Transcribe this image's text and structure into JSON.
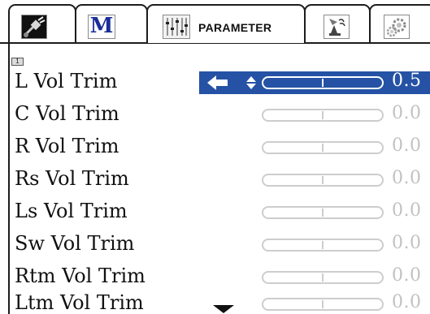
{
  "tabs": [
    {
      "name": "input",
      "icon": "plug-cable-icon"
    },
    {
      "name": "menu",
      "icon": "m-logo-icon",
      "glyph": "M"
    },
    {
      "name": "parameter",
      "icon": "equalizer-sliders-icon",
      "label": "PARAMETER"
    },
    {
      "name": "speaker",
      "icon": "speaker-satellite-icon"
    },
    {
      "name": "system",
      "icon": "gears-icon"
    }
  ],
  "page_badge": "1",
  "rows": [
    {
      "label": "L Vol Trim",
      "value": "0.5",
      "level": 0.5,
      "selected": true
    },
    {
      "label": "C Vol Trim",
      "value": "0.0",
      "level": 0.5,
      "selected": false
    },
    {
      "label": "R Vol Trim",
      "value": "0.0",
      "level": 0.5,
      "selected": false
    },
    {
      "label": "Rs Vol Trim",
      "value": "0.0",
      "level": 0.5,
      "selected": false
    },
    {
      "label": "Ls Vol Trim",
      "value": "0.0",
      "level": 0.5,
      "selected": false
    },
    {
      "label": "Sw Vol Trim",
      "value": "0.0",
      "level": 0.5,
      "selected": false
    },
    {
      "label": "Rtm Vol Trim",
      "value": "0.0",
      "level": 0.5,
      "selected": false
    },
    {
      "label": "Ltm Vol Trim",
      "value": "0.0",
      "level": 0.5,
      "selected": false
    }
  ],
  "colors": {
    "selection": "#2552a5",
    "text": "#111111",
    "inactive": "#c2c2c2",
    "m_logo": "#1a2e9a"
  }
}
